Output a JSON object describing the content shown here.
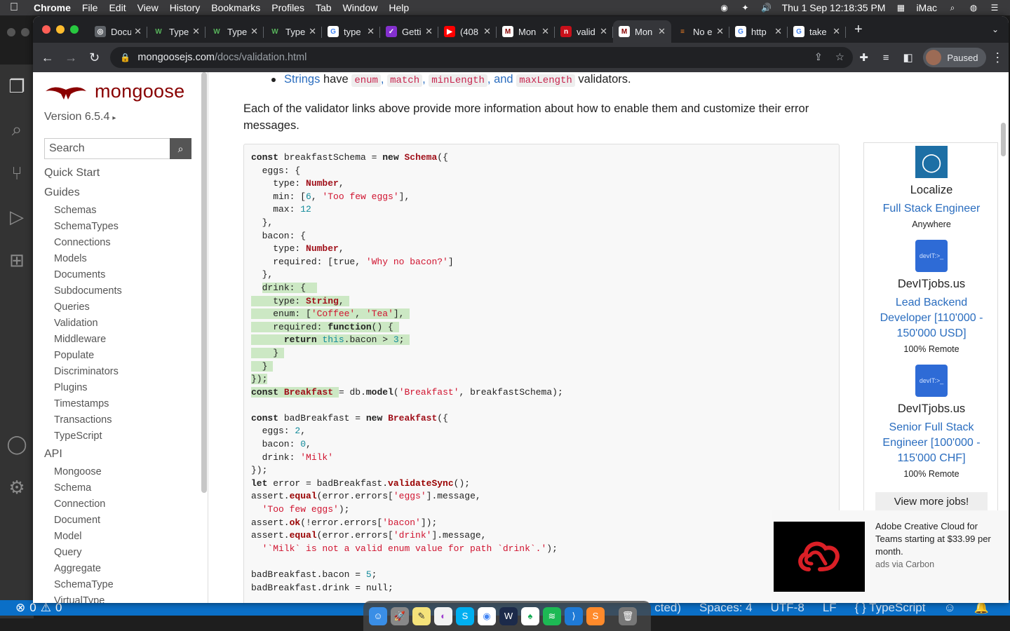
{
  "menubar": {
    "app": "Chrome",
    "items": [
      "File",
      "Edit",
      "View",
      "History",
      "Bookmarks",
      "Profiles",
      "Tab",
      "Window",
      "Help"
    ],
    "datetime": "Thu 1 Sep  12:18:35 PM",
    "machine": "iMac"
  },
  "tabs": [
    {
      "title": "Docu",
      "fav_bg": "#5f6368",
      "fav_fg": "#fff",
      "fav_char": "◎"
    },
    {
      "title": "Type",
      "fav_bg": "#202124",
      "fav_fg": "#57b35b",
      "fav_char": "W"
    },
    {
      "title": "Type",
      "fav_bg": "#202124",
      "fav_fg": "#57b35b",
      "fav_char": "W"
    },
    {
      "title": "Type",
      "fav_bg": "#202124",
      "fav_fg": "#57b35b",
      "fav_char": "W"
    },
    {
      "title": "type",
      "fav_bg": "#fff",
      "fav_fg": "#4285f4",
      "fav_char": "G"
    },
    {
      "title": "Getti",
      "fav_bg": "#8430ce",
      "fav_fg": "#fff",
      "fav_char": "✓"
    },
    {
      "title": "(408",
      "fav_bg": "#f00",
      "fav_fg": "#fff",
      "fav_char": "▶"
    },
    {
      "title": "Mon",
      "fav_bg": "#fff",
      "fav_fg": "#800",
      "fav_char": "M"
    },
    {
      "title": "valid",
      "fav_bg": "#c8101a",
      "fav_fg": "#fff",
      "fav_char": "n"
    },
    {
      "title": "Mon",
      "fav_bg": "#fff",
      "fav_fg": "#800",
      "fav_char": "M",
      "active": true
    },
    {
      "title": "No e",
      "fav_bg": "#202124",
      "fav_fg": "#f48024",
      "fav_char": "≡"
    },
    {
      "title": "http",
      "fav_bg": "#fff",
      "fav_fg": "#4285f4",
      "fav_char": "G"
    },
    {
      "title": "take",
      "fav_bg": "#fff",
      "fav_fg": "#4285f4",
      "fav_char": "G"
    }
  ],
  "omnibox": {
    "host": "mongoosejs.com",
    "path": "/docs/validation.html"
  },
  "profile": {
    "label": "Paused"
  },
  "sidebar": {
    "brand": "mongoose",
    "version": "Version 6.5.4",
    "search_placeholder": "Search",
    "quick_start": "Quick Start",
    "guides": "Guides",
    "guide_items": [
      "Schemas",
      "SchemaTypes",
      "Connections",
      "Models",
      "Documents",
      "Subdocuments",
      "Queries",
      "Validation",
      "Middleware",
      "Populate",
      "Discriminators",
      "Plugins",
      "Timestamps",
      "Transactions",
      "TypeScript"
    ],
    "api": "API",
    "api_items": [
      "Mongoose",
      "Schema",
      "Connection",
      "Document",
      "Model",
      "Query",
      "Aggregate",
      "SchemaType",
      "VirtualType"
    ]
  },
  "content": {
    "bullet_link": "Strings",
    "bullet_have": " have ",
    "bullet_c1": "enum",
    "bullet_c2": "match",
    "bullet_c3": "minLength",
    "bullet_and": ", and ",
    "bullet_c4": "maxLength",
    "bullet_tail": " validators.",
    "paragraph": "Each of the validator links above provide more information about how to enable them and customize their error messages."
  },
  "ads": {
    "jobs": [
      {
        "company": "Localize",
        "title": "Full Stack Engineer",
        "location": "Anywhere",
        "logo_bg": "#1d6fa5",
        "logo_text": "◯"
      },
      {
        "company": "DevITjobs.us",
        "title": "Lead Backend Developer [110'000 - 150'000 USD]",
        "location": "100% Remote",
        "logo_bg": "#2e6bd6",
        "logo_text": "devIT:>_"
      },
      {
        "company": "DevITjobs.us",
        "title": "Senior Full Stack Engineer [100'000 - 115'000 CHF]",
        "location": "100% Remote",
        "logo_bg": "#2e6bd6",
        "logo_text": "devIT:>_"
      }
    ],
    "more": "View more jobs!"
  },
  "carbon": {
    "text": "Adobe Creative Cloud for Teams starting at $33.99 per month.",
    "via": "ads via Carbon"
  },
  "vscode_status": {
    "errors": "0",
    "warnings": "0",
    "mode": "cted)",
    "spaces": "Spaces: 4",
    "encoding": "UTF-8",
    "eol": "LF",
    "lang": "{ } TypeScript"
  }
}
